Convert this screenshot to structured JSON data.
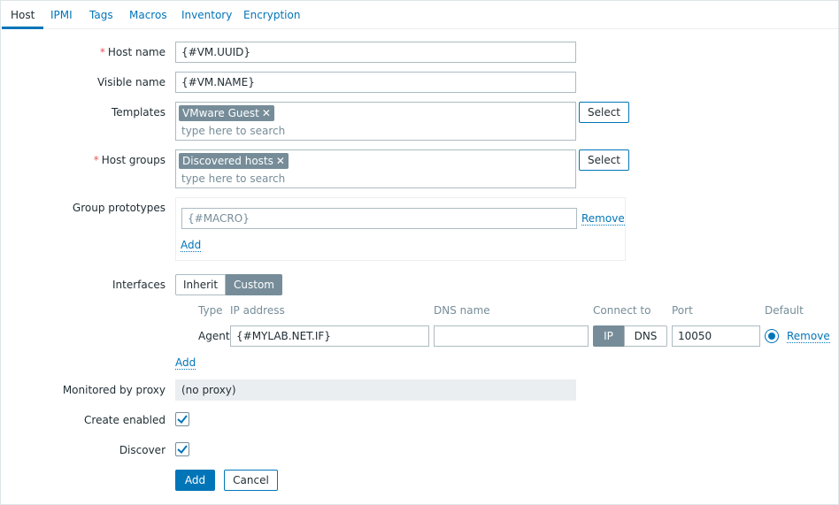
{
  "tabs": [
    {
      "label": "Host",
      "active": true
    },
    {
      "label": "IPMI",
      "active": false
    },
    {
      "label": "Tags",
      "active": false
    },
    {
      "label": "Macros",
      "active": false
    },
    {
      "label": "Inventory",
      "active": false
    },
    {
      "label": "Encryption",
      "active": false
    }
  ],
  "form": {
    "host_name": {
      "label": "Host name",
      "required_mark": "*",
      "value": "{#VM.UUID}"
    },
    "visible_name": {
      "label": "Visible name",
      "value": "{#VM.NAME}"
    },
    "templates": {
      "label": "Templates",
      "chip": "VMware Guest",
      "chip_remove": "✕",
      "placeholder": "type here to search",
      "select_label": "Select"
    },
    "host_groups": {
      "label": "Host groups",
      "required_mark": "*",
      "chip": "Discovered hosts",
      "chip_remove": "✕",
      "placeholder": "type here to search",
      "select_label": "Select"
    },
    "group_prototypes": {
      "label": "Group prototypes",
      "placeholder": "{#MACRO}",
      "remove_label": "Remove",
      "add_label": "Add"
    },
    "interfaces": {
      "label": "Interfaces",
      "modes": [
        "Inherit",
        "Custom"
      ],
      "selected_mode": "Custom",
      "columns": [
        "Type",
        "IP address",
        "DNS name",
        "Connect to",
        "Port",
        "Default"
      ],
      "row": {
        "type": "Agent",
        "ip": "{#MYLAB.NET.IF}",
        "dns": "",
        "connect_options": [
          "IP",
          "DNS"
        ],
        "connect_selected": "IP",
        "port": "10050",
        "default": true,
        "remove_label": "Remove"
      },
      "add_label": "Add"
    },
    "proxy": {
      "label": "Monitored by proxy",
      "value": "(no proxy)"
    },
    "create_enabled": {
      "label": "Create enabled",
      "checked": true
    },
    "discover": {
      "label": "Discover",
      "checked": true
    },
    "buttons": {
      "submit": "Add",
      "cancel": "Cancel"
    }
  },
  "colors": {
    "accent": "#0275b8",
    "chip": "#768d99",
    "required": "#e45959"
  }
}
